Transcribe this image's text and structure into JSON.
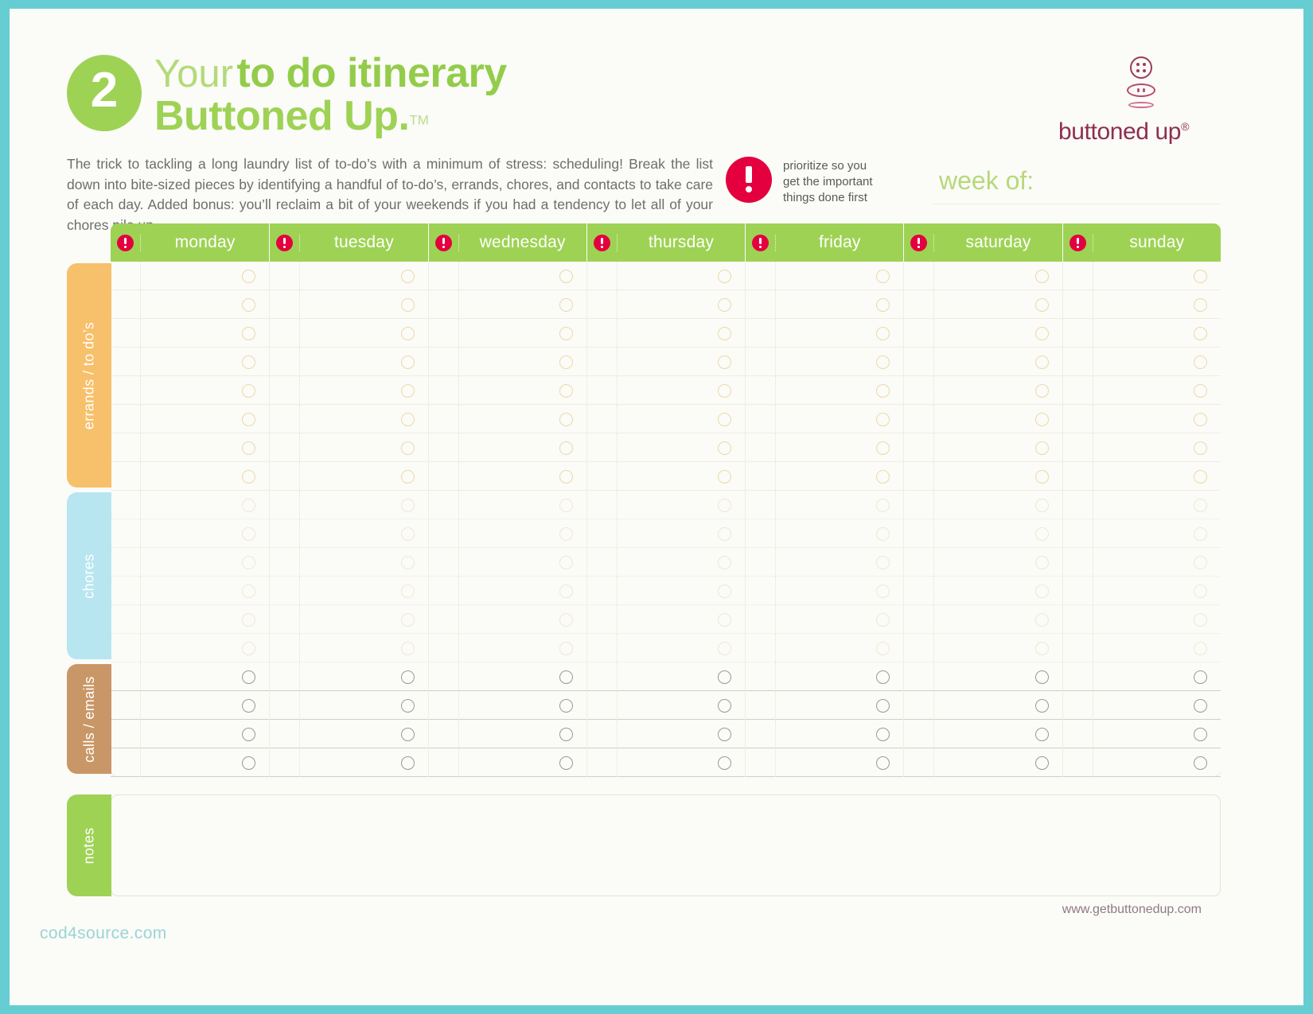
{
  "page": {
    "frame_color": "#66cdd2",
    "background": "#fbfbf8"
  },
  "header": {
    "step_number": "2",
    "title_prefix": "Your",
    "title_strong": "to do itinerary",
    "title_second_line": "Buttoned Up",
    "title_second_line_period": ".",
    "trademark": "TM",
    "accent_green": "#9ed254"
  },
  "logo": {
    "wordmark": "buttoned up",
    "registered": "®",
    "icon_name": "buttons-stack-icon",
    "color": "#8e2f50"
  },
  "intro": {
    "text": "The trick to tackling a long laundry list of to-do’s with a minimum of stress: scheduling! Break the list down into bite-sized pieces by identifying a handful of to-do’s, errands, chores, and contacts to take care of each day. Added bonus: you’ll reclaim a bit of your weekends if you had a tendency to let all of your chores pile up."
  },
  "prioritize": {
    "icon_name": "exclamation-badge-icon",
    "icon_color": "#e4003f",
    "line1": "prioritize so you",
    "line2": "get the important",
    "line3": "things done first"
  },
  "week_of": {
    "label": "week of:",
    "value": ""
  },
  "grid": {
    "days": [
      "monday",
      "tuesday",
      "wednesday",
      "thursday",
      "friday",
      "saturday",
      "sunday"
    ],
    "priority_icon_name": "priority-exclamation-icon",
    "header_bg": "#9ed254",
    "sections": [
      {
        "key": "errands",
        "label": "errands / to do’s",
        "tab_color": "#f7c06a",
        "bubble_color": "#ecd9a7",
        "rows": 8
      },
      {
        "key": "chores",
        "label": "chores",
        "tab_color": "#b8e6f0",
        "bubble_color": "#efe9d3",
        "rows": 6
      },
      {
        "key": "calls",
        "label": "calls / emails",
        "tab_color": "#c99767",
        "bubble_color": "#9a9a93",
        "rows": 4
      }
    ]
  },
  "notes": {
    "label": "notes",
    "tab_color": "#9ed254",
    "value": ""
  },
  "footer": {
    "site_url": "www.getbuttonedup.com",
    "watermark": "cod4source.com"
  }
}
